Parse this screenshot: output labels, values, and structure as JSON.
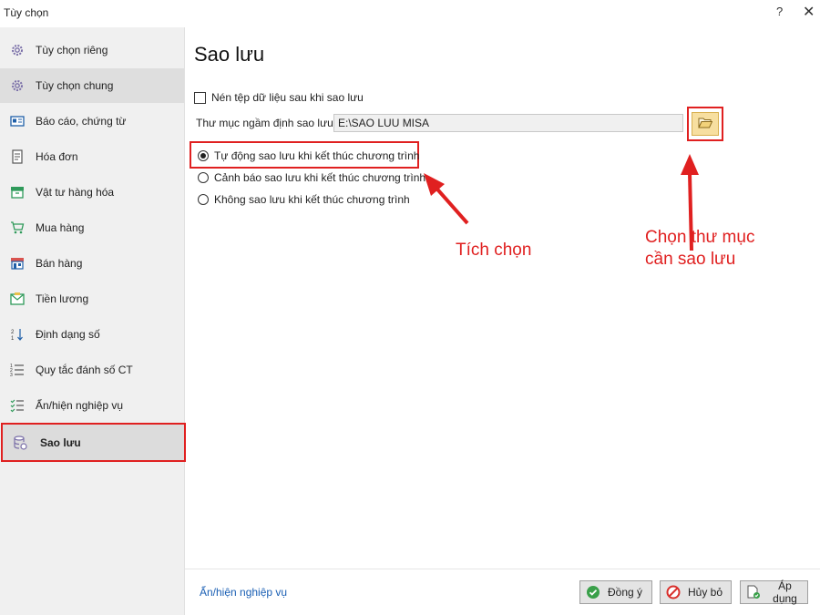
{
  "window": {
    "title": "Tùy chọn",
    "help_label": "?",
    "close_label": "✕"
  },
  "sidebar": {
    "items": [
      {
        "label": "Tùy chọn riêng",
        "icon": "gear-icon"
      },
      {
        "label": "Tùy chọn chung",
        "icon": "gear-icon"
      },
      {
        "label": "Báo cáo, chứng từ",
        "icon": "report-icon"
      },
      {
        "label": "Hóa đơn",
        "icon": "invoice-icon"
      },
      {
        "label": "Vật tư hàng hóa",
        "icon": "inventory-box-icon"
      },
      {
        "label": "Mua hàng",
        "icon": "shopping-cart-icon"
      },
      {
        "label": "Bán hàng",
        "icon": "store-icon"
      },
      {
        "label": "Tiền lương",
        "icon": "salary-envelope-icon"
      },
      {
        "label": "Định dạng số",
        "icon": "number-format-icon"
      },
      {
        "label": "Quy tắc đánh số CT",
        "icon": "numbered-list-icon"
      },
      {
        "label": "Ẩn/hiện nghiệp vụ",
        "icon": "checklist-icon"
      },
      {
        "label": "Sao lưu",
        "icon": "database-backup-icon"
      }
    ],
    "active_index": 11
  },
  "main": {
    "title": "Sao lưu",
    "compress_checkbox": {
      "label": "Nén tệp dữ liệu sau khi sao lưu",
      "checked": false
    },
    "default_folder": {
      "label": "Thư mục ngầm định sao lưu",
      "value": "E:\\SAO LUU MISA",
      "browse_icon": "folder-open-icon"
    },
    "radios": [
      {
        "label": "Tự động sao lưu khi kết thúc chương trình",
        "selected": true
      },
      {
        "label": "Cảnh báo sao lưu khi kết thúc chương trình",
        "selected": false
      },
      {
        "label": "Không sao lưu khi kết thúc chương trình",
        "selected": false
      }
    ]
  },
  "annotations": {
    "tick_label": "Tích chọn",
    "folder_label_line1": "Chọn thư mục",
    "folder_label_line2": "cần sao lưu",
    "color": "#e02020"
  },
  "footer": {
    "link": "Ẩn/hiện nghiệp vụ",
    "ok_label": "Đồng ý",
    "cancel_label": "Hủy bỏ",
    "apply_label": "Áp dụng"
  }
}
